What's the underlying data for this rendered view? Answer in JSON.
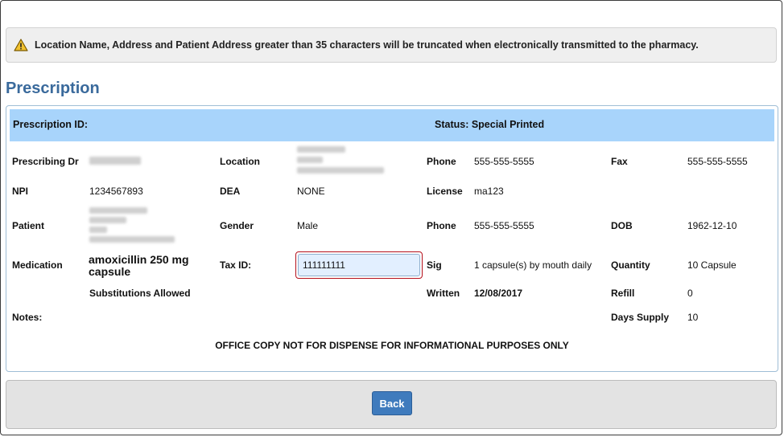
{
  "warning": {
    "text": "Location Name, Address and Patient Address greater than 35 characters will be truncated when electronically transmitted to the pharmacy.",
    "icon": "warning-triangle-icon",
    "icon_color": "#f2c230"
  },
  "section_title": "Prescription",
  "header": {
    "prescription_id_label": "Prescription ID:",
    "status_label": "Status: Special Printed",
    "background": "#a8d4fb"
  },
  "fields": {
    "prescribing_dr_label": "Prescribing Dr",
    "location_label": "Location",
    "phone_label": "Phone",
    "phone_value": "555-555-5555",
    "fax_label": "Fax",
    "fax_value": "555-555-5555",
    "npi_label": "NPI",
    "npi_value": "1234567893",
    "dea_label": "DEA",
    "dea_value": "NONE",
    "license_label": "License",
    "license_value": "ma123",
    "patient_label": "Patient",
    "gender_label": "Gender",
    "gender_value": "Male",
    "patient_phone_label": "Phone",
    "patient_phone_value": "555-555-5555",
    "dob_label": "DOB",
    "dob_value": "1962-12-10",
    "medication_label": "Medication",
    "medication_value": "amoxicillin 250 mg capsule",
    "tax_id_label": "Tax ID:",
    "tax_id_value": "111111111",
    "sig_label": "Sig",
    "sig_value": "1 capsule(s) by mouth daily",
    "quantity_label": "Quantity",
    "quantity_value": "10 Capsule",
    "substitutions": "Substitutions Allowed",
    "written_label": "Written",
    "written_value": "12/08/2017",
    "refill_label": "Refill",
    "refill_value": "0",
    "notes_label": "Notes:",
    "days_supply_label": "Days Supply",
    "days_supply_value": "10"
  },
  "office_copy": "OFFICE COPY NOT FOR DISPENSE FOR INFORMATIONAL PURPOSES ONLY",
  "footer": {
    "back_label": "Back",
    "back_color": "#3f7bbd"
  }
}
